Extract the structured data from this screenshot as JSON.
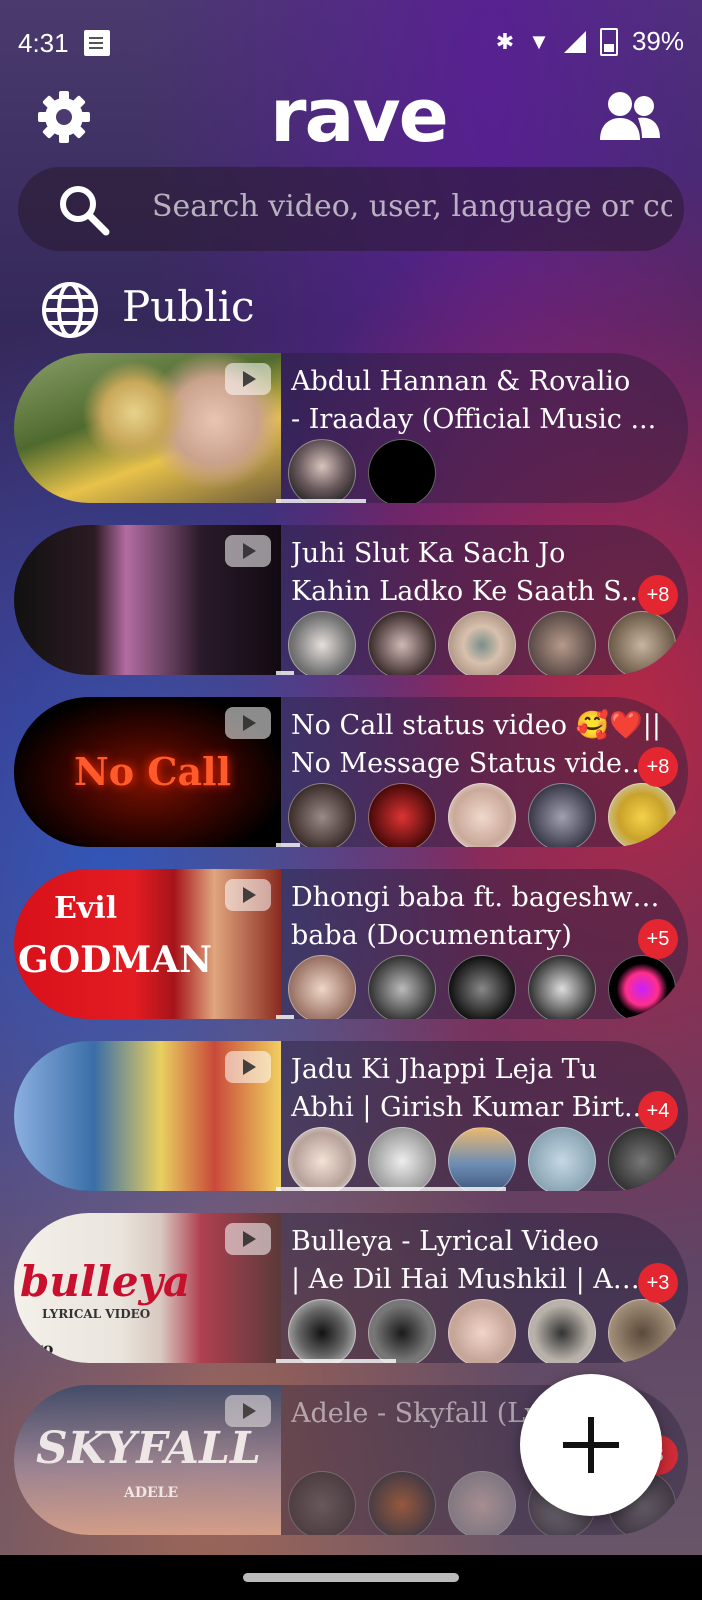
{
  "status_bar": {
    "time": "4:31",
    "battery": "39%",
    "icons": [
      "document-icon",
      "bluetooth-icon",
      "wifi-icon",
      "signal-icon",
      "battery-icon"
    ]
  },
  "header": {
    "logo": "rave",
    "settings_icon": "gear-icon",
    "friends_icon": "people-icon"
  },
  "search": {
    "placeholder": "Search video, user, language or cou"
  },
  "section": {
    "label": "Public",
    "icon": "globe-icon"
  },
  "videos": [
    {
      "title_line1": "Abdul Hannan & Rovalio",
      "title_line2": "- Iraaday (Official Music ...",
      "extra": "",
      "avatar_count": 2,
      "progress": 0.35
    },
    {
      "title_line1": "Juhi Slut Ka Sach Jo",
      "title_line2": "Kahin Ladko Ke Saath S...",
      "extra": "+8",
      "avatar_count": 5,
      "progress": 0.05
    },
    {
      "title_line1": "No Call status video 🥰❤️||",
      "title_line2": "No Message Status video...",
      "extra": "+8",
      "avatar_count": 5,
      "progress": 0.06,
      "thumb_text": "No Call"
    },
    {
      "title_line1": "Dhongi baba ft. bageshwar",
      "title_line2": "baba (Documentary)",
      "extra": "+5",
      "avatar_count": 5,
      "progress": 0.05,
      "thumb_text_a": "Evil",
      "thumb_text_b": "GODMAN"
    },
    {
      "title_line1": "Jadu Ki Jhappi Leja Tu",
      "title_line2": "Abhi | Girish Kumar Birt...",
      "extra": "+4",
      "avatar_count": 5,
      "progress": 0.55
    },
    {
      "title_line1": "Bulleya - Lyrical Video",
      "title_line2": "| Ae Dil Hai Mushkil | Am...",
      "extra": "+3",
      "avatar_count": 5,
      "progress": 0.3,
      "thumb_text_a": "bulleya",
      "thumb_text_b": "LYRICAL VIDEO",
      "thumb_text_c": "vevo"
    },
    {
      "title_line1": "Adele - Skyfall (Ly",
      "title_line2": "",
      "extra": "3",
      "avatar_count": 5,
      "progress": 0.0,
      "thumb_text_a": "SKYFALL",
      "thumb_text_b": "ADELE"
    }
  ],
  "fab": {
    "icon": "plus-icon"
  },
  "colors": {
    "badge": "#e3262f",
    "fab": "#ffffff"
  }
}
